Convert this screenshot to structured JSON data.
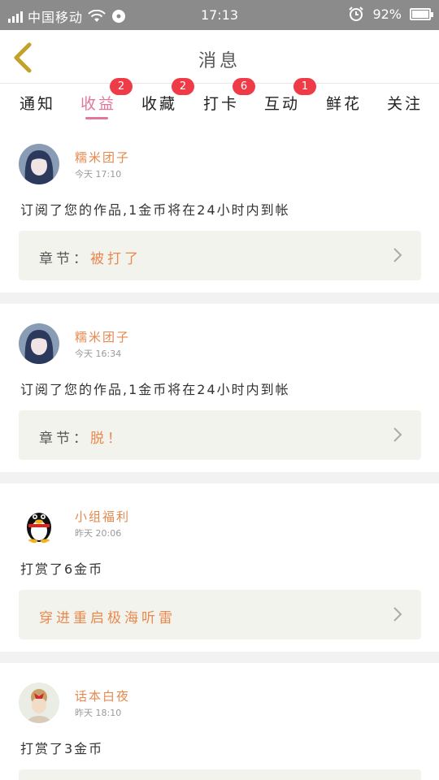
{
  "status_bar": {
    "carrier": "中国移动",
    "time": "17:13",
    "battery": "92%"
  },
  "header": {
    "title": "消息"
  },
  "tabs": [
    {
      "label": "通知",
      "badge": ""
    },
    {
      "label": "收益",
      "badge": "2",
      "active": true
    },
    {
      "label": "收藏",
      "badge": "2"
    },
    {
      "label": "打卡",
      "badge": "6"
    },
    {
      "label": "互动",
      "badge": "1"
    },
    {
      "label": "鲜花",
      "badge": ""
    },
    {
      "label": "关注",
      "badge": ""
    }
  ],
  "messages": [
    {
      "user": "糯米团子",
      "time": "今天 17:10",
      "text": "订阅了您的作品,1金币将在24小时内到帐",
      "chapter_label": "章节：",
      "chapter_value": "被打了"
    },
    {
      "user": "糯米团子",
      "time": "今天 16:34",
      "text": "订阅了您的作品,1金币将在24小时内到帐",
      "chapter_label": "章节：",
      "chapter_value": "脱！"
    },
    {
      "user": "小组福利",
      "time": "昨天 20:06",
      "text": "打赏了6金币",
      "chapter_label": "",
      "chapter_value": "穿进重启极海听雷"
    },
    {
      "user": "话本白夜",
      "time": "昨天 18:10",
      "text": "打赏了3金币"
    }
  ],
  "colors": {
    "accent_pink": "#e2779b",
    "name_orange": "#e8884d",
    "badge_red": "#ef3b48"
  }
}
